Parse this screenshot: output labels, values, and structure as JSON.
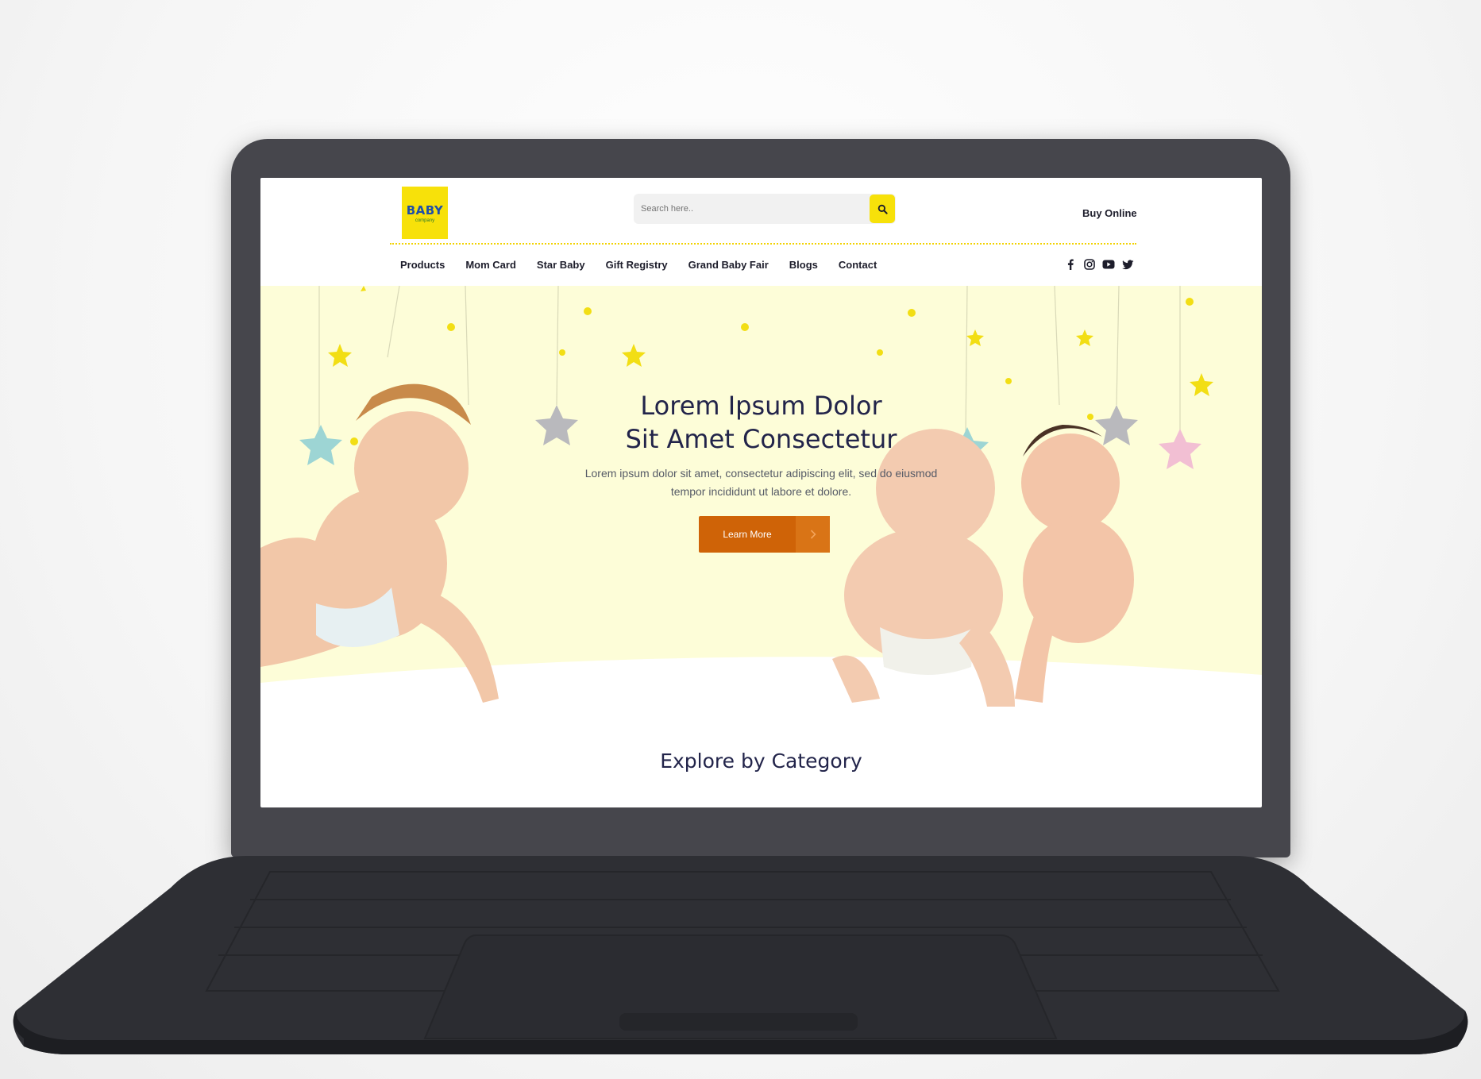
{
  "logo": {
    "text": "BABY",
    "sub": "company"
  },
  "search": {
    "placeholder": "Search here.."
  },
  "header": {
    "buy_online": "Buy Online"
  },
  "nav": {
    "items": [
      {
        "label": "Products"
      },
      {
        "label": "Mom Card"
      },
      {
        "label": "Star Baby"
      },
      {
        "label": "Gift Registry"
      },
      {
        "label": "Grand Baby Fair"
      },
      {
        "label": "Blogs"
      },
      {
        "label": "Contact"
      }
    ]
  },
  "social": [
    "facebook-icon",
    "instagram-icon",
    "youtube-icon",
    "twitter-icon"
  ],
  "hero": {
    "title_line1": "Lorem Ipsum Dolor",
    "title_line2": "Sit Amet Consectetur",
    "subtitle_line1": "Lorem ipsum dolor sit amet, consectetur adipiscing elit, sed do eiusmod",
    "subtitle_line2": "tempor incididunt ut labore et dolore.",
    "cta_label": "Learn More"
  },
  "explore": {
    "title": "Explore by Category"
  },
  "colors": {
    "accent_yellow": "#f7e10a",
    "hero_bg": "#fdfdd8",
    "cta_orange": "#cf6307",
    "heading_navy": "#22244a",
    "laptop_body": "#46464c"
  }
}
